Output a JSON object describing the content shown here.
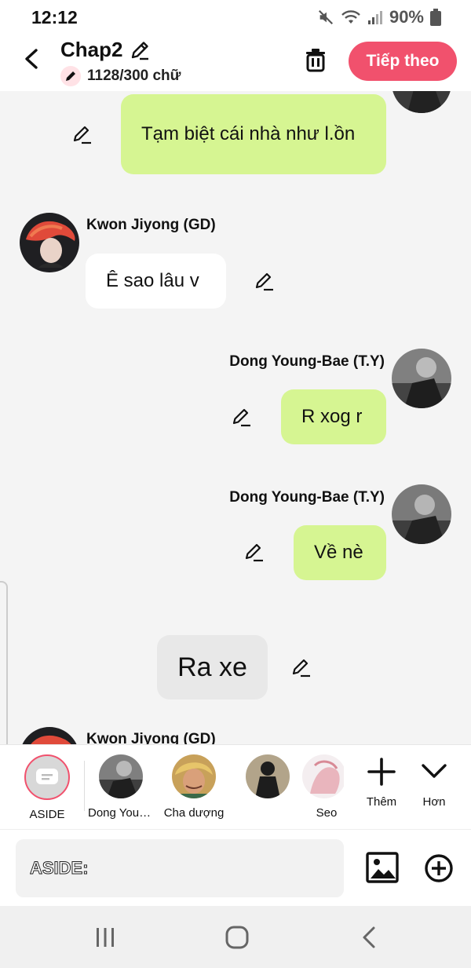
{
  "status": {
    "time": "12:12",
    "battery": "90%"
  },
  "header": {
    "title": "Chap2",
    "word_count": "1128/300 chữ",
    "next_label": "Tiếp theo"
  },
  "messages": [
    {
      "type": "right",
      "text": "Tạm biệt cái nhà như l.ồn"
    },
    {
      "type": "left",
      "sender": "Kwon Jiyong (GD)",
      "text": "Ê sao lâu v"
    },
    {
      "type": "right",
      "sender": "Dong Young-Bae (T.Y)",
      "text": "R xog r"
    },
    {
      "type": "right",
      "sender": "Dong Young-Bae (T.Y)",
      "text": "Về nè"
    },
    {
      "type": "aside",
      "text": "Ra xe"
    },
    {
      "type": "left",
      "sender": "Kwon Jiyong (GD)"
    }
  ],
  "characters": [
    {
      "label": "ASIDE"
    },
    {
      "label": "Dong Young-Bae (T.Y)"
    },
    {
      "label": "Cha dượng"
    },
    {
      "label": ""
    },
    {
      "label": "Seo"
    }
  ],
  "tools": {
    "more_label": "Thêm",
    "collapse_label": "Hơn"
  },
  "input": {
    "placeholder": "ASIDE:"
  },
  "colors": {
    "accent": "#f1516d",
    "bubble_green": "#d6f592"
  }
}
